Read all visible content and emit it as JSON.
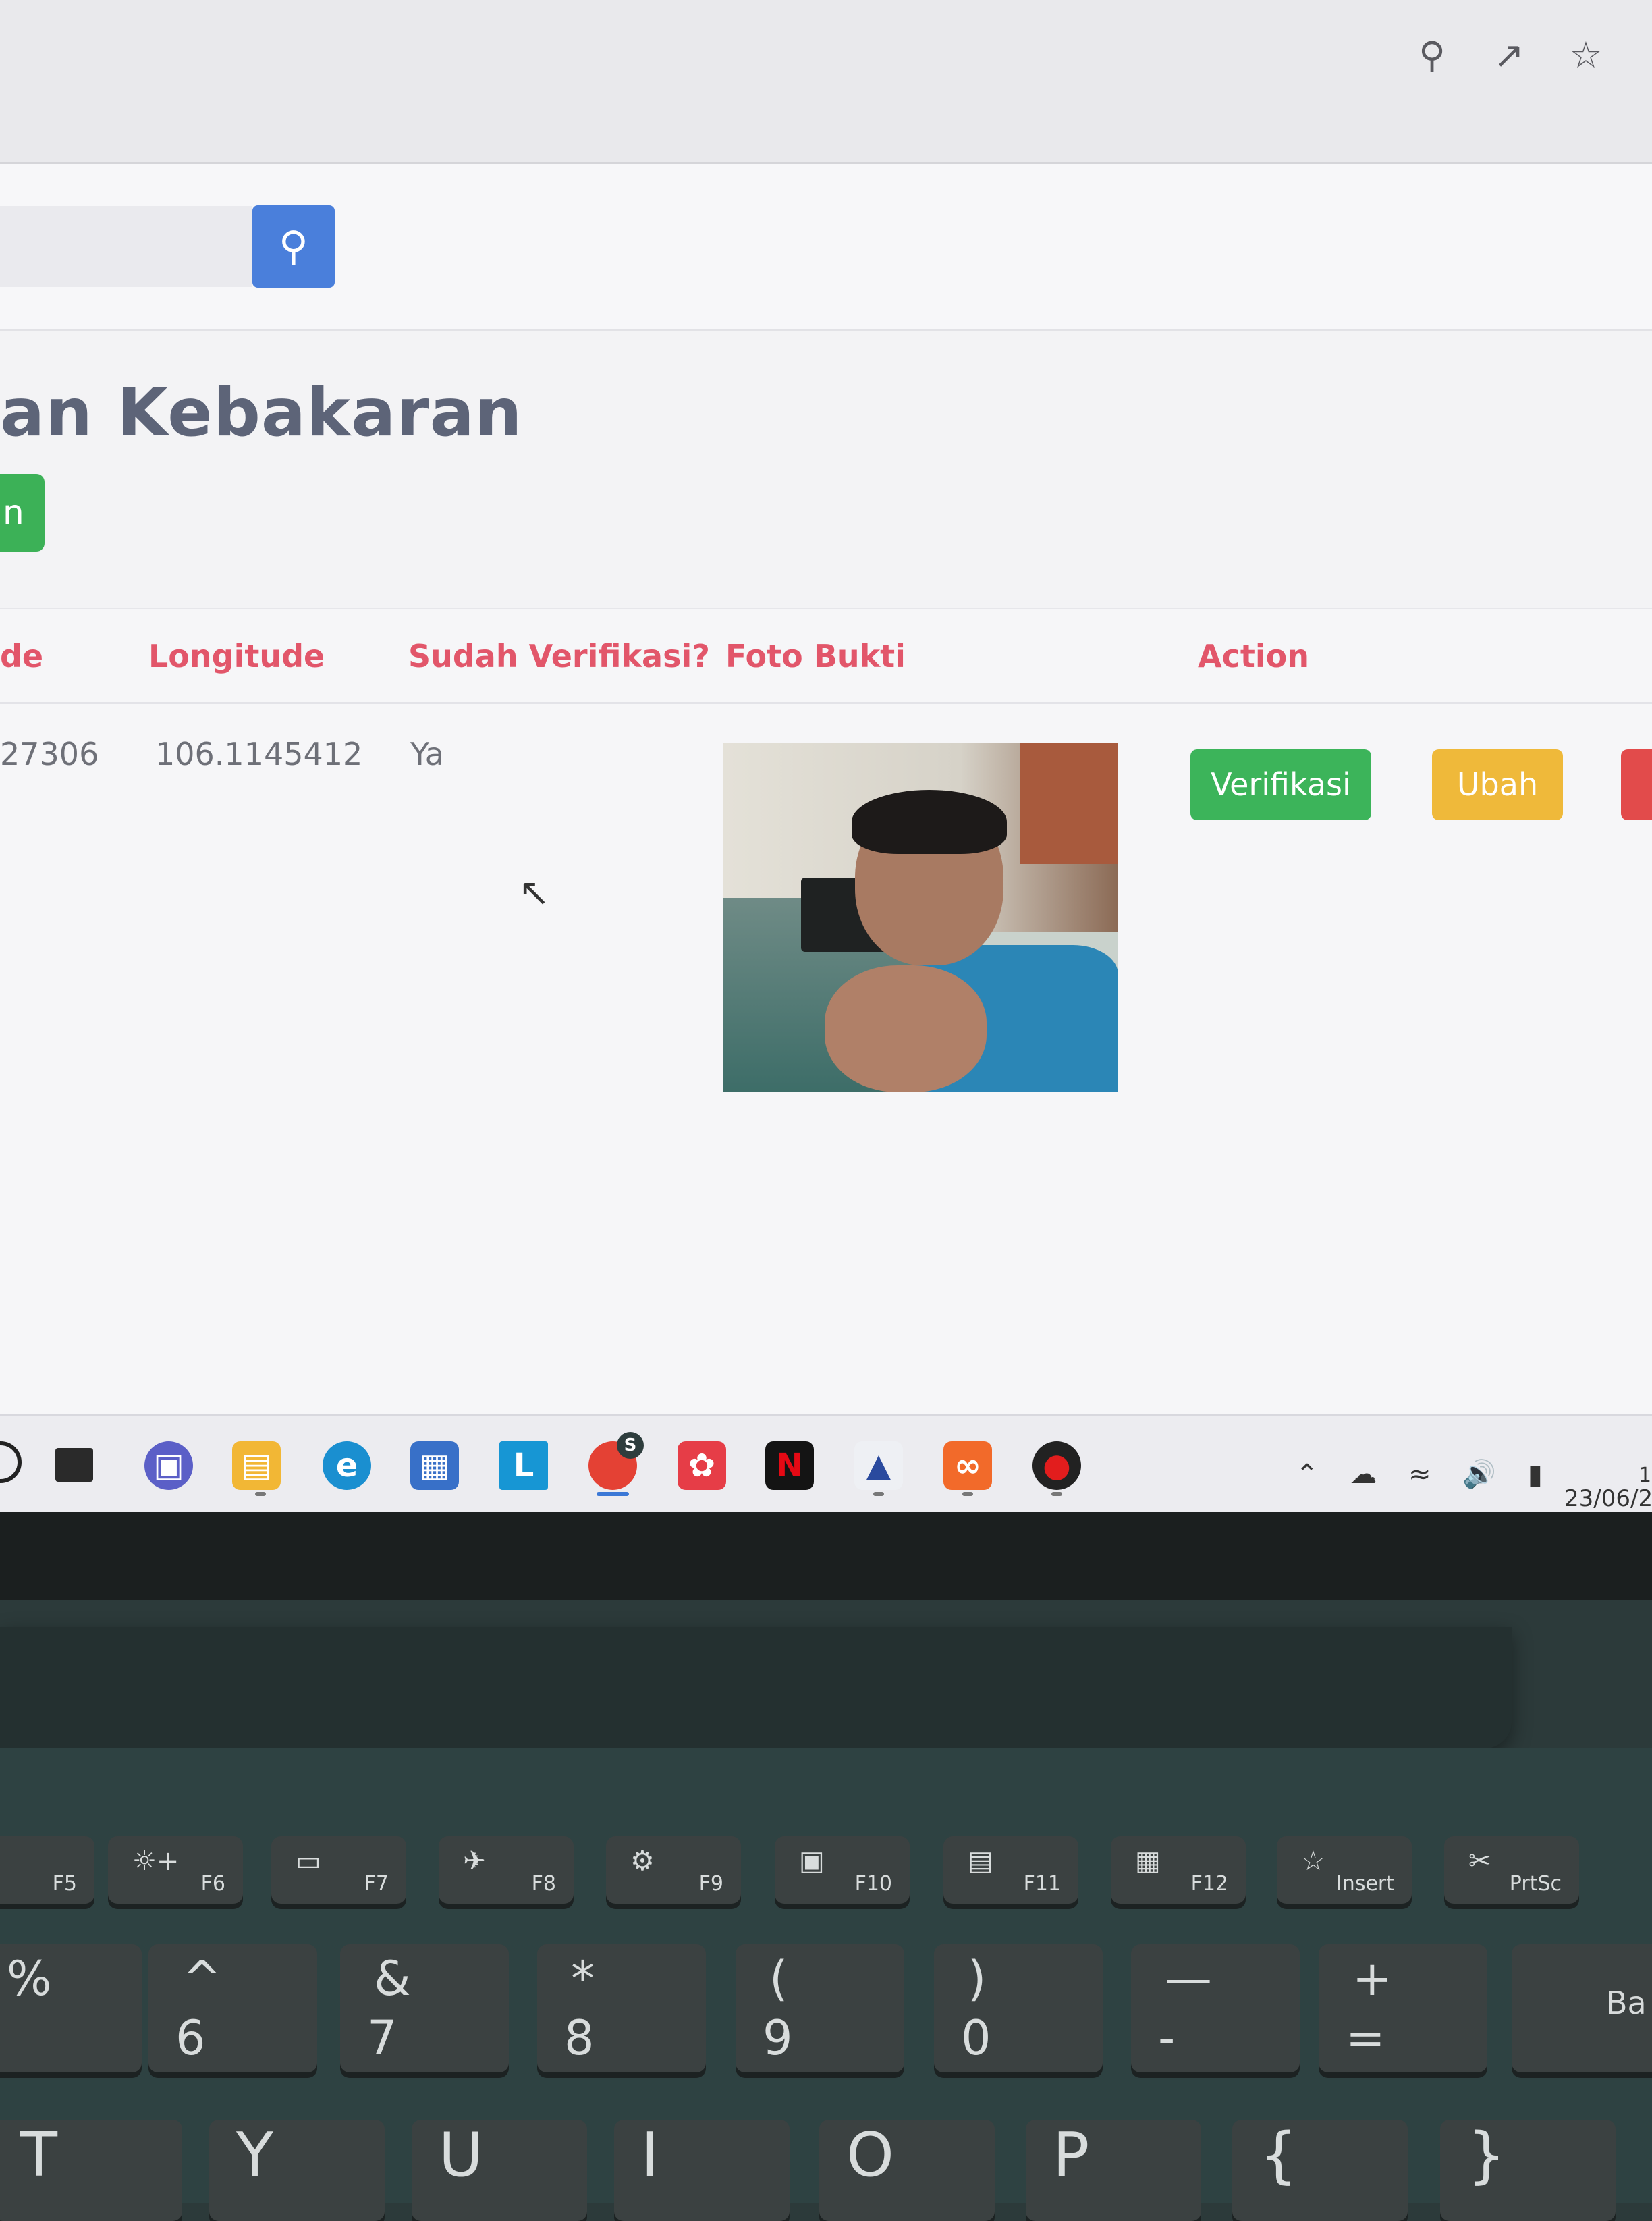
{
  "browser": {
    "icons": [
      "zoom-out-icon",
      "share-icon",
      "star-icon"
    ]
  },
  "search": {
    "placeholder": "",
    "button_icon": "search-icon"
  },
  "page": {
    "title": "an Kebakaran",
    "add_button_label": "n"
  },
  "table": {
    "headers": {
      "latitude": "de",
      "longitude": "Longitude",
      "verified": "Sudah Verifikasi?",
      "photo": "Foto Bukti",
      "action": "Action"
    },
    "rows": [
      {
        "latitude": "27306",
        "longitude": "106.1145412",
        "verified": "Ya",
        "actions": {
          "verify": "Verifikasi",
          "edit": "Ubah"
        }
      }
    ]
  },
  "taskbar": {
    "l_app_label": "L",
    "chrome_badge": "S",
    "netflix_label": "N",
    "tray_date": "23/06/2",
    "tray_time": "1"
  },
  "keyboard": {
    "fkeys": [
      "F5",
      "F6",
      "F7",
      "F8",
      "F9",
      "F10",
      "F11",
      "F12",
      "Insert",
      "PrtSc"
    ],
    "number_row": [
      {
        "top": "%",
        "bottom": ""
      },
      {
        "top": "^",
        "bottom": "6"
      },
      {
        "top": "&",
        "bottom": "7"
      },
      {
        "top": "*",
        "bottom": "8"
      },
      {
        "top": "(",
        "bottom": "9"
      },
      {
        "top": ")",
        "bottom": "0"
      },
      {
        "top": "—",
        "bottom": "-"
      },
      {
        "top": "+",
        "bottom": "="
      },
      {
        "top": "Ba",
        "bottom": ""
      }
    ],
    "letter_row": [
      "T",
      "Y",
      "U",
      "I",
      "O",
      "P",
      "{",
      "}"
    ]
  },
  "colors": {
    "header_text": "#e2566a",
    "verify_button": "#3cb45a",
    "edit_button": "#efb93a",
    "delete_button": "#e24b4b",
    "search_button": "#4a7fdb"
  }
}
